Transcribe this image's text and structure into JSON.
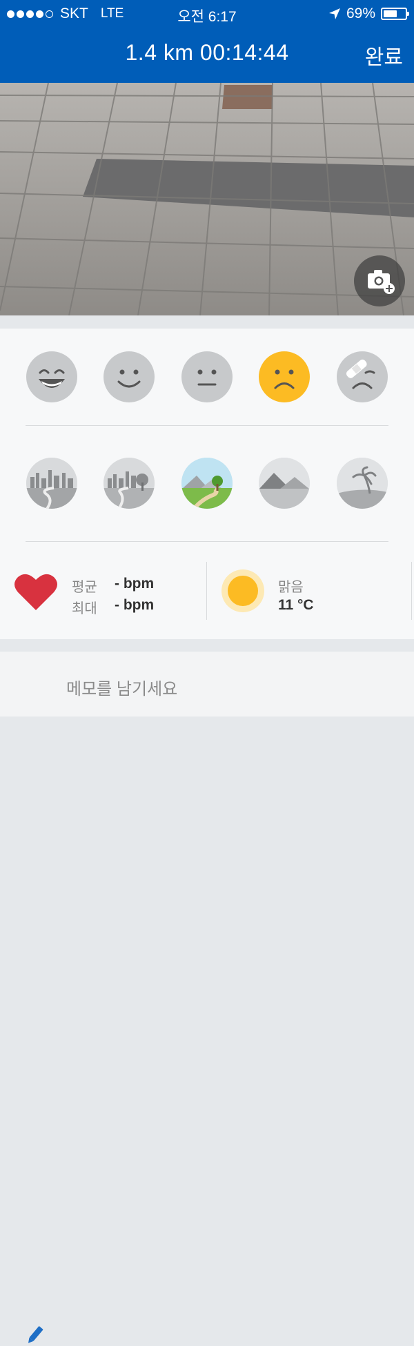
{
  "status_bar": {
    "carrier": "SKT",
    "network": "LTE",
    "time": "오전 6:17",
    "battery": "69%",
    "battery_level": 0.69,
    "signal_dots_filled": 4,
    "signal_dots_total": 5
  },
  "header": {
    "title": "1.4 km 00:14:44",
    "done_label": "완료",
    "color": "#005db8"
  },
  "photo": {
    "camera_icon": "camera-add-icon"
  },
  "moods": [
    {
      "icon": "mood-great-icon",
      "selected": false
    },
    {
      "icon": "mood-good-icon",
      "selected": false
    },
    {
      "icon": "mood-neutral-icon",
      "selected": false
    },
    {
      "icon": "mood-sad-icon",
      "selected": true
    },
    {
      "icon": "mood-injured-icon",
      "selected": false
    }
  ],
  "mood_selected_color": "#fcbb23",
  "terrains": [
    {
      "icon": "terrain-city-road-icon",
      "selected": false
    },
    {
      "icon": "terrain-city-park-icon",
      "selected": false
    },
    {
      "icon": "terrain-trail-icon",
      "selected": true
    },
    {
      "icon": "terrain-mountain-icon",
      "selected": false
    },
    {
      "icon": "terrain-beach-icon",
      "selected": false
    }
  ],
  "heart_rate": {
    "avg_label": "평균",
    "avg_value": "- bpm",
    "max_label": "최대",
    "max_value": "- bpm",
    "icon": "heart-icon",
    "color": "#d8323f"
  },
  "weather": {
    "condition": "맑음",
    "temperature": "11 °C",
    "icon": "sun-icon",
    "color": "#fcbb23"
  },
  "memo": {
    "placeholder": "메모를 남기세요",
    "icon": "pencil-icon"
  }
}
